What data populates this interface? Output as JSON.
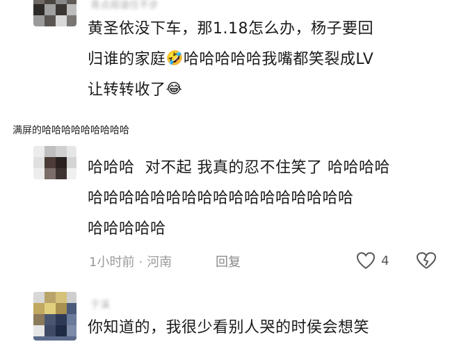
{
  "post_caption": "满屏的哈哈哈哈哈哈哈哈哈",
  "comments": [
    {
      "username": "青点阁谐任不步",
      "text_lines": [
        "黄圣依没下车，那1.18怎么办，杨子要回",
        "归谁的家庭",
        "哈哈哈哈哈我嘴都笑裂成LV",
        "让转转收了"
      ],
      "emojis": [
        "rolling-laugh-emoji",
        "tears-of-joy-emoji"
      ]
    },
    {
      "username": "",
      "text_lines": [
        "哈哈哈  对不起 我真的忍不住笑了 哈哈哈哈",
        "哈哈哈哈哈哈哈哈哈哈哈哈哈哈哈哈哈",
        "哈哈哈哈哈"
      ],
      "time": "1小时前",
      "location": "河南",
      "reply_label": "回复",
      "like_count": "4"
    },
    {
      "username": "于溪",
      "text_lines": [
        "你知道的，我很少看别人哭的时侯会想笑"
      ]
    }
  ]
}
